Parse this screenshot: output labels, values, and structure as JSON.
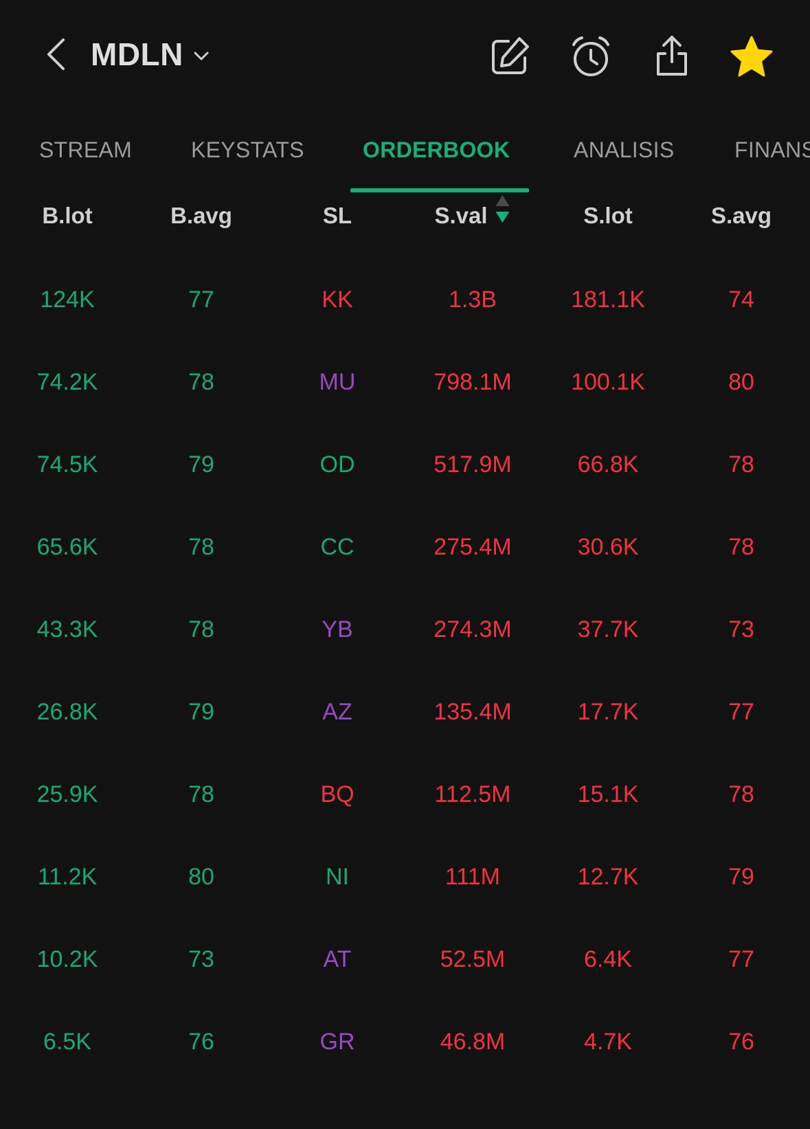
{
  "header": {
    "ticker": "MDLN"
  },
  "tabs": [
    {
      "label": "STREAM",
      "active": false
    },
    {
      "label": "KEYSTATS",
      "active": false
    },
    {
      "label": "ORDERBOOK",
      "active": true
    },
    {
      "label": "ANALISIS",
      "active": false
    },
    {
      "label": "FINANS",
      "active": false
    }
  ],
  "columns": [
    "B.lot",
    "B.avg",
    "SL",
    "S.val",
    "S.lot",
    "S.avg"
  ],
  "sort_column": "S.val",
  "colors": {
    "background": "#121212",
    "green": "#1aa873",
    "red": "#f0343f",
    "purple": "#9a49c4",
    "star": "#ffd60a",
    "accent": "#17b079"
  },
  "rows": [
    {
      "blot": "124K",
      "bavg": "77",
      "sl": "KK",
      "sl_color": "red",
      "sval": "1.3B",
      "slot": "181.1K",
      "savg": "74"
    },
    {
      "blot": "74.2K",
      "bavg": "78",
      "sl": "MU",
      "sl_color": "purple",
      "sval": "798.1M",
      "slot": "100.1K",
      "savg": "80"
    },
    {
      "blot": "74.5K",
      "bavg": "79",
      "sl": "OD",
      "sl_color": "green",
      "sval": "517.9M",
      "slot": "66.8K",
      "savg": "78"
    },
    {
      "blot": "65.6K",
      "bavg": "78",
      "sl": "CC",
      "sl_color": "green",
      "sval": "275.4M",
      "slot": "30.6K",
      "savg": "78"
    },
    {
      "blot": "43.3K",
      "bavg": "78",
      "sl": "YB",
      "sl_color": "purple",
      "sval": "274.3M",
      "slot": "37.7K",
      "savg": "73"
    },
    {
      "blot": "26.8K",
      "bavg": "79",
      "sl": "AZ",
      "sl_color": "purple",
      "sval": "135.4M",
      "slot": "17.7K",
      "savg": "77"
    },
    {
      "blot": "25.9K",
      "bavg": "78",
      "sl": "BQ",
      "sl_color": "red",
      "sval": "112.5M",
      "slot": "15.1K",
      "savg": "78"
    },
    {
      "blot": "11.2K",
      "bavg": "80",
      "sl": "NI",
      "sl_color": "green",
      "sval": "111M",
      "slot": "12.7K",
      "savg": "79"
    },
    {
      "blot": "10.2K",
      "bavg": "73",
      "sl": "AT",
      "sl_color": "purple",
      "sval": "52.5M",
      "slot": "6.4K",
      "savg": "77"
    },
    {
      "blot": "6.5K",
      "bavg": "76",
      "sl": "GR",
      "sl_color": "purple",
      "sval": "46.8M",
      "slot": "4.7K",
      "savg": "76"
    }
  ]
}
